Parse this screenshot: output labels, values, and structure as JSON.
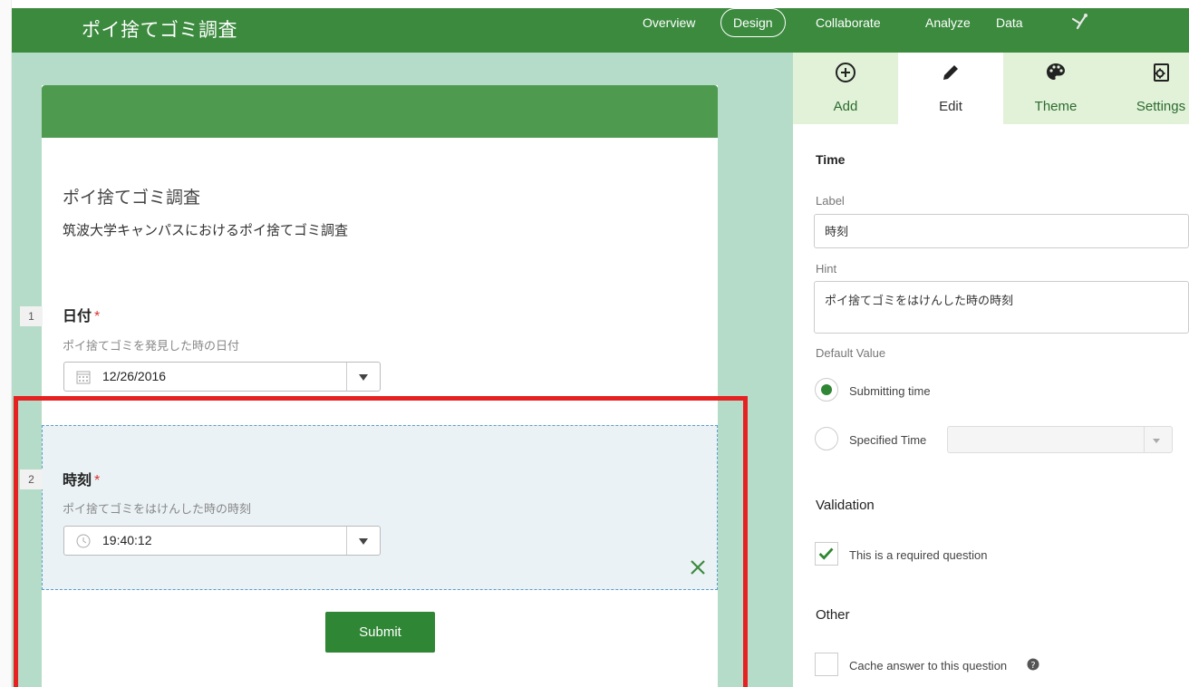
{
  "app": {
    "title": "ポイ捨てゴミ調査"
  },
  "nav": {
    "overview": "Overview",
    "design": "Design",
    "collaborate": "Collaborate",
    "analyze": "Analyze",
    "data": "Data"
  },
  "form": {
    "title": "ポイ捨てゴミ調査",
    "description": "筑波大学キャンパスにおけるポイ捨てゴミ調査",
    "questions": [
      {
        "number": "1",
        "label": "日付",
        "required_mark": "*",
        "hint": "ポイ捨てゴミを発見した時の日付",
        "value": "12/26/2016",
        "icon": "calendar-icon"
      },
      {
        "number": "2",
        "label": "時刻",
        "required_mark": "*",
        "hint": "ポイ捨てゴミをはけんした時の時刻",
        "value": "19:40:12",
        "icon": "clock-icon"
      }
    ],
    "submit_label": "Submit"
  },
  "panel": {
    "tabs": [
      {
        "label": "Add",
        "icon": "add-circle-icon"
      },
      {
        "label": "Edit",
        "icon": "pencil-icon"
      },
      {
        "label": "Theme",
        "icon": "palette-icon"
      },
      {
        "label": "Settings",
        "icon": "settings-gear-icon"
      }
    ],
    "active_tab": "Edit",
    "section_title": "Time",
    "label_field": {
      "label": "Label",
      "value": "時刻"
    },
    "hint_field": {
      "label": "Hint",
      "value": "ポイ捨てゴミをはけんした時の時刻"
    },
    "default_value": {
      "label": "Default Value",
      "options": [
        "Submitting time",
        "Specified Time"
      ],
      "selected": "Submitting time"
    },
    "validation": {
      "title": "Validation",
      "required_label": "This is a required question",
      "required_checked": true
    },
    "other": {
      "title": "Other",
      "cache_label": "Cache answer to this question",
      "cache_checked": false
    }
  },
  "colors": {
    "brand_green": "#3b8a3e",
    "canvas_bg": "#b5dcc8",
    "highlight_red": "#e52121",
    "tabbar_bg": "#e1f2d8"
  }
}
